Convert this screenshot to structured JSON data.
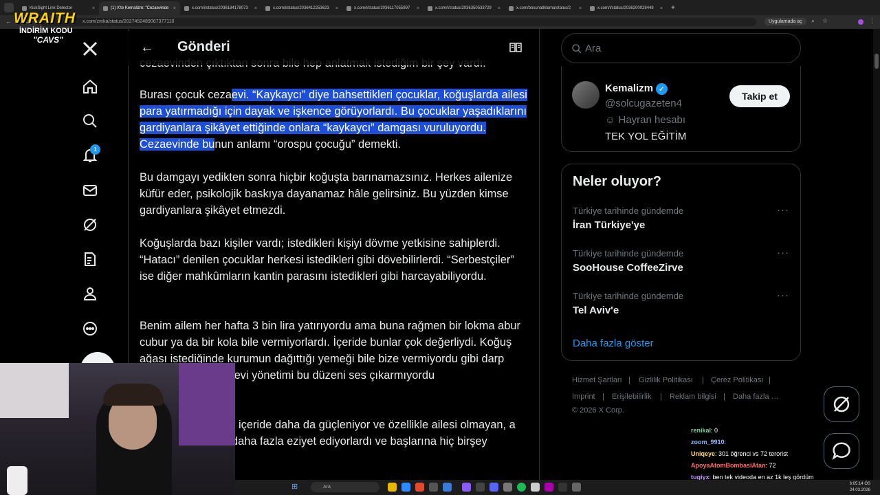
{
  "browser": {
    "tabs": [
      {
        "label": "KickSight Link Detector",
        "active": false
      },
      {
        "label": "(1) X'te Kemalizm: \"Cezaevinde",
        "active": true
      },
      {
        "label": "x.com/i/status/2036184178073",
        "active": false
      },
      {
        "label": "x.com/i/status/2036412253623",
        "active": false
      },
      {
        "label": "x.com/i/status/2036117055997",
        "active": false
      },
      {
        "label": "x.com/i/status/2036350533729",
        "active": false
      },
      {
        "label": "x.com/bosunatiklama/status/2",
        "active": false
      },
      {
        "label": "x.com/i/status/2036200028448",
        "active": false
      }
    ],
    "url": "x.com/zmka/status/2027452489067377110",
    "app_chip": "Uygulamada aç"
  },
  "overlay_logo": {
    "line1": "WRAITH",
    "line2": "İNDİRİM KODU",
    "line3": "\"CAVS\""
  },
  "nav": {
    "notification_count": "1"
  },
  "header": {
    "title": "Gönderi"
  },
  "post": {
    "top_partial": "cezaevinden çıktıktan sonra bile hep anlatmak istediğim bir şey vardı:",
    "paragraphs": [
      {
        "plain_before": "Burası çocuk ceza",
        "highlight": "evi. “Kaykaycı” diye bahsettikleri çocuklar, koğuşlarda ailesi para yatırmadığı için dayak ve işkence görüyorlardı. Bu çocuklar yaşadıklarını gardiyanlara şikâyet ettiğinde onlara “kaykaycı” damgası vuruluyordu. Cezaevinde bu",
        "plain_after": "nun anlamı “orospu çocuğu” demekti."
      },
      {
        "plain_before": "Bu damgayı yedikten sonra hiçbir koğuşta barınamazsınız. Herkes ailenize küfür eder, psikolojik baskıya dayanamaz hâle gelirsiniz. Bu yüzden kimse gardiyanlara şikâyet etmezdi.",
        "highlight": "",
        "plain_after": ""
      },
      {
        "plain_before": "Koğuşlarda bazı kişiler vardı; istedikleri kişiyi dövme yetkisine sahiplerdi. “Hatacı” denilen çocuklar herkesi istedikleri gibi dövebilirlerdi. “Serbestçiler” ise diğer mahkûmların kantin parasını istedikleri gibi harcayabiliyordu.",
        "highlight": "",
        "plain_after": ""
      },
      {
        "plain_before": "Benim ailem her hafta 3 bin lira yatırıyordu ama buna rağmen bir lokma abur cubur ya da bir kola bile vermiyorlardı. İçeride bunlar çok değerliydi. Koğuş ağası istediğinde kurumun dağıttığı yemeği bile bize vermiyordu gibi darp ediyorlardı ve cezaevi yönetimi bu düzeni ses çıkarmıyordu",
        "highlight": "",
        "plain_after": ""
      },
      {
        "plain_before": "r içeride daha da güçleniyor ve özellikle ailesi olmayan, a daha fazla eziyet ediyorlardı ve başlarına hiç birşey",
        "highlight": "",
        "plain_after": ""
      }
    ]
  },
  "search": {
    "placeholder": "Ara"
  },
  "profile": {
    "name": "Kemalizm",
    "handle": "@solcugazeten4",
    "fan_label": "Hayran hesabı",
    "bio": "TEK YOL EĞİTİM",
    "follow_label": "Takip et"
  },
  "trends": {
    "title": "Neler oluyor?",
    "items": [
      {
        "category": "Türkiye tarihinde gündemde",
        "name": "İran Türkiye'ye"
      },
      {
        "category": "Türkiye tarihinde gündemde",
        "name": "SooHouse CoffeeZirve"
      },
      {
        "category": "Türkiye tarihinde gündemde",
        "name": "Tel Aviv'e"
      }
    ],
    "show_more": "Daha fazla göster"
  },
  "footer": {
    "links": [
      "Hizmet Şartları",
      "Gizlilik Politikası",
      "Çerez Politikası",
      "Imprint",
      "Erişilebilirlik",
      "Reklam bilgisi",
      "Daha fazla …"
    ],
    "copyright": "© 2026 X Corp."
  },
  "chat": [
    {
      "user": "renikal",
      "msg": ": 0",
      "color": "#7ec8a0"
    },
    {
      "user": "zoom_9910",
      "msg": ":",
      "color": "#8fb8ff"
    },
    {
      "user": "Uniqeye",
      "msg": ": 301 öğrenci vs 72 terorist",
      "color": "#ffd966"
    },
    {
      "user": "ApoyaAtomBombasiAtan",
      "msg": ": 72",
      "color": "#ff6b6b"
    },
    {
      "user": "tugiyx",
      "msg": ": ben tek videoda en az 1k leş gördüm",
      "color": "#c89bff"
    },
    {
      "user": "Rjoner",
      "msg": ": ayn ayn",
      "color": "#8fd3ff"
    }
  ],
  "taskbar": {
    "search_placeholder": "Ara",
    "time": "6:05:14 ÖS",
    "date": "24.03.2026"
  }
}
